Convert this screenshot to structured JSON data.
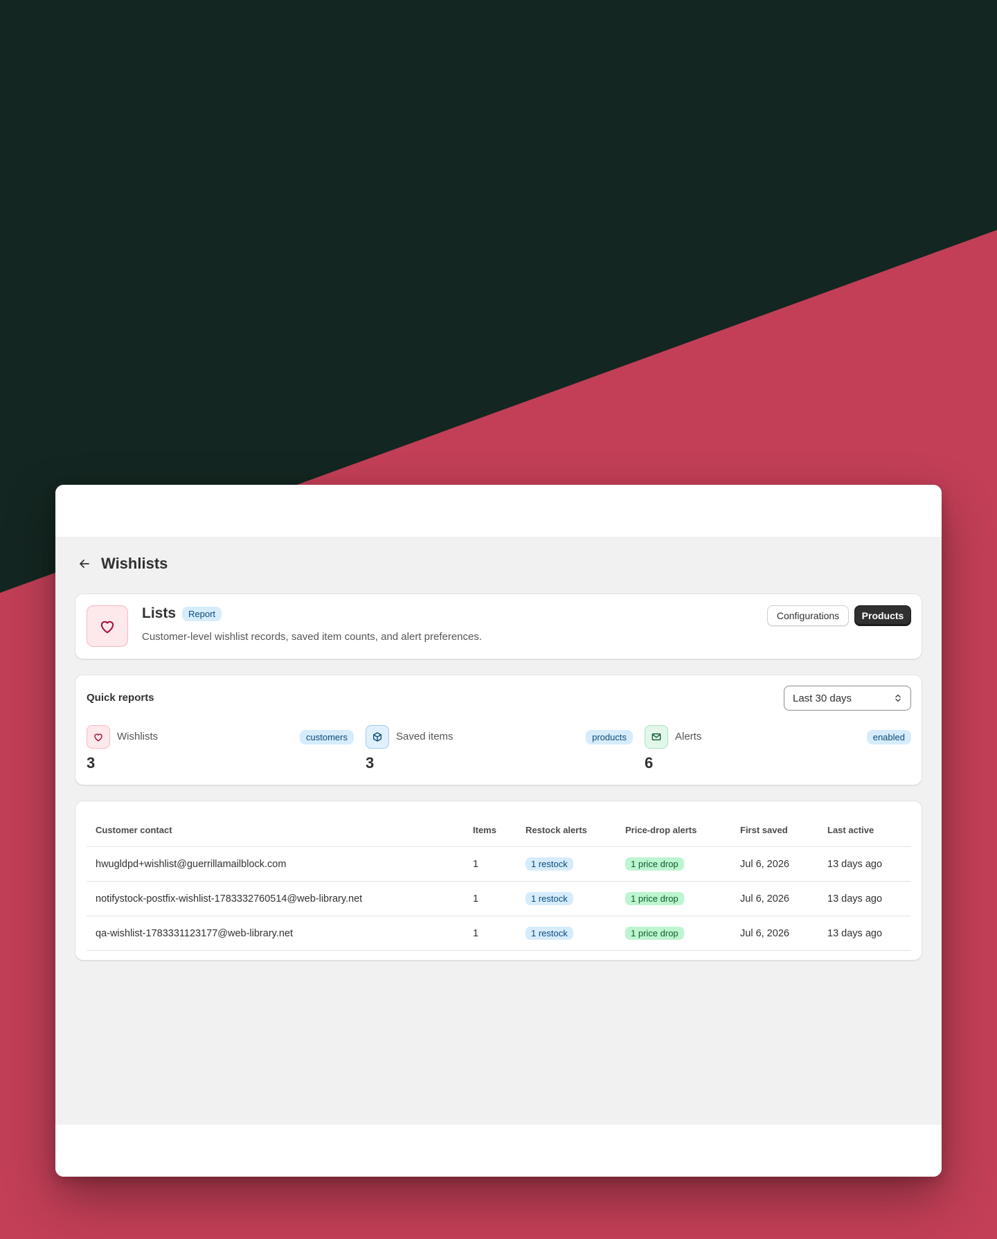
{
  "header": {
    "title": "Wishlists"
  },
  "list_card": {
    "title": "Lists",
    "badge": "Report",
    "description": "Customer-level wishlist records, saved item counts, and alert preferences.",
    "configurations_label": "Configurations",
    "products_label": "Products",
    "icon": "heart-icon"
  },
  "quick_reports": {
    "title": "Quick reports",
    "range_select": {
      "value": "Last 30 days"
    },
    "stats": [
      {
        "label": "Wishlists",
        "tag": "customers",
        "value": "3",
        "icon": "heart-icon"
      },
      {
        "label": "Saved items",
        "tag": "products",
        "value": "3",
        "icon": "box-icon"
      },
      {
        "label": "Alerts",
        "tag": "enabled",
        "value": "6",
        "icon": "mail-icon"
      }
    ]
  },
  "table": {
    "columns": [
      "Customer contact",
      "Items",
      "Restock alerts",
      "Price-drop alerts",
      "First saved",
      "Last active"
    ],
    "rows": [
      {
        "contact": "hwugldpd+wishlist@guerrillamailblock.com",
        "items": "1",
        "restock": "1 restock",
        "price_drop": "1 price drop",
        "first_saved": "Jul 6, 2026",
        "last_active": "13 days ago"
      },
      {
        "contact": "notifystock-postfix-wishlist-1783332760514@web-library.net",
        "items": "1",
        "restock": "1 restock",
        "price_drop": "1 price drop",
        "first_saved": "Jul 6, 2026",
        "last_active": "13 days ago"
      },
      {
        "contact": "qa-wishlist-1783331123177@web-library.net",
        "items": "1",
        "restock": "1 restock",
        "price_drop": "1 price drop",
        "first_saved": "Jul 6, 2026",
        "last_active": "13 days ago"
      }
    ]
  },
  "colors": {
    "background_dark": "#142621",
    "background_accent": "#c23f57",
    "primary_button": "#303030",
    "badge_blue": "#d6ecfc",
    "badge_green": "#bcf5cf"
  }
}
